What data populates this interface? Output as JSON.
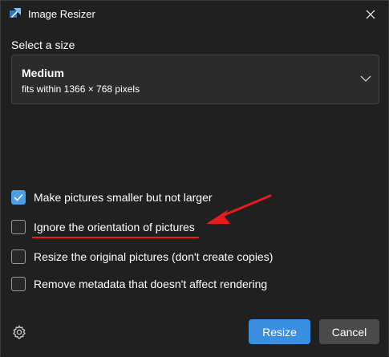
{
  "window": {
    "title": "Image Resizer",
    "app_icon": "image-resizer-app-icon",
    "close_icon": "close-icon"
  },
  "size_section": {
    "label": "Select a size",
    "selected": {
      "name": "Medium",
      "description": "fits within 1366 × 768 pixels"
    },
    "dropdown_icon": "chevron-down-icon"
  },
  "options": [
    {
      "label": "Make pictures smaller but not larger",
      "checked": true
    },
    {
      "label": "Ignore the orientation of pictures",
      "checked": false
    },
    {
      "label": "Resize the original pictures (don't create copies)",
      "checked": false
    },
    {
      "label": "Remove metadata that doesn't affect rendering",
      "checked": false
    }
  ],
  "footer": {
    "settings_icon": "gear-icon",
    "resize_label": "Resize",
    "cancel_label": "Cancel"
  },
  "colors": {
    "background": "#202020",
    "accent": "#3b8fe0",
    "checkbox_checked": "#4a9fe6",
    "annotation_red": "#e81b1b"
  }
}
